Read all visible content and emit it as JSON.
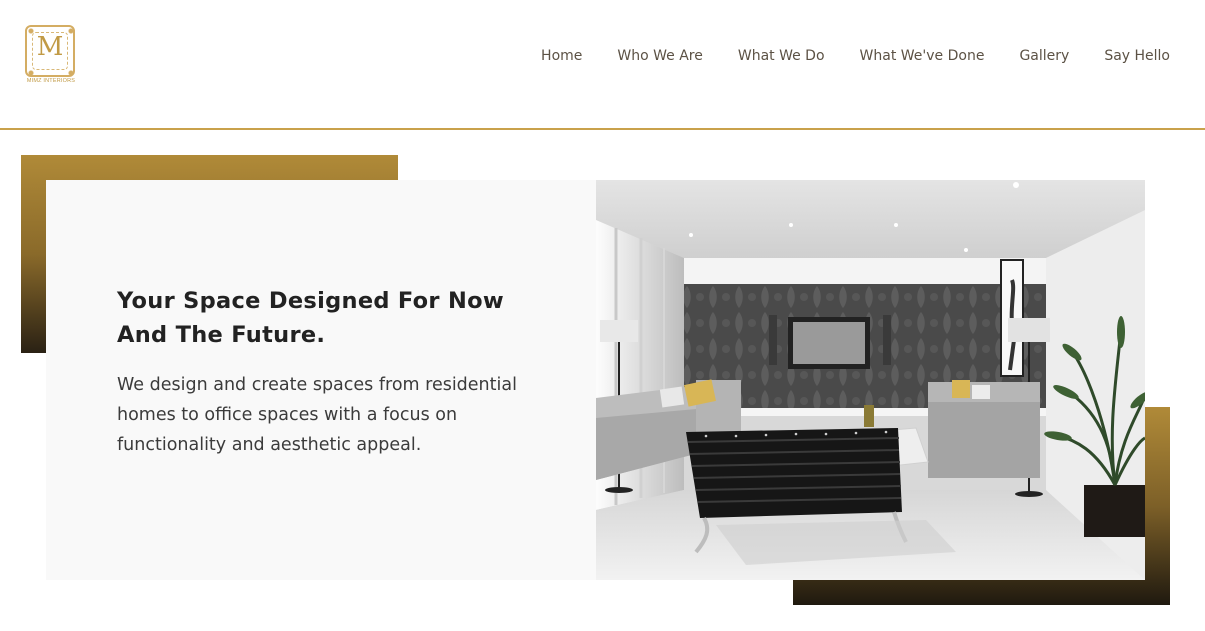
{
  "brand": {
    "logo_letter": "M",
    "logo_text": "MIMZ INTERIORS",
    "accent_color": "#c9a14b"
  },
  "nav": {
    "items": [
      {
        "label": "Home"
      },
      {
        "label": "Who We Are"
      },
      {
        "label": "What We Do"
      },
      {
        "label": "What We've Done"
      },
      {
        "label": "Gallery"
      },
      {
        "label": "Say Hello"
      }
    ]
  },
  "hero": {
    "headline": "Your Space Designed For Now And The Future.",
    "description": "We design and create spaces from residential homes to office spaces with a focus on functionality and aesthetic appeal."
  }
}
